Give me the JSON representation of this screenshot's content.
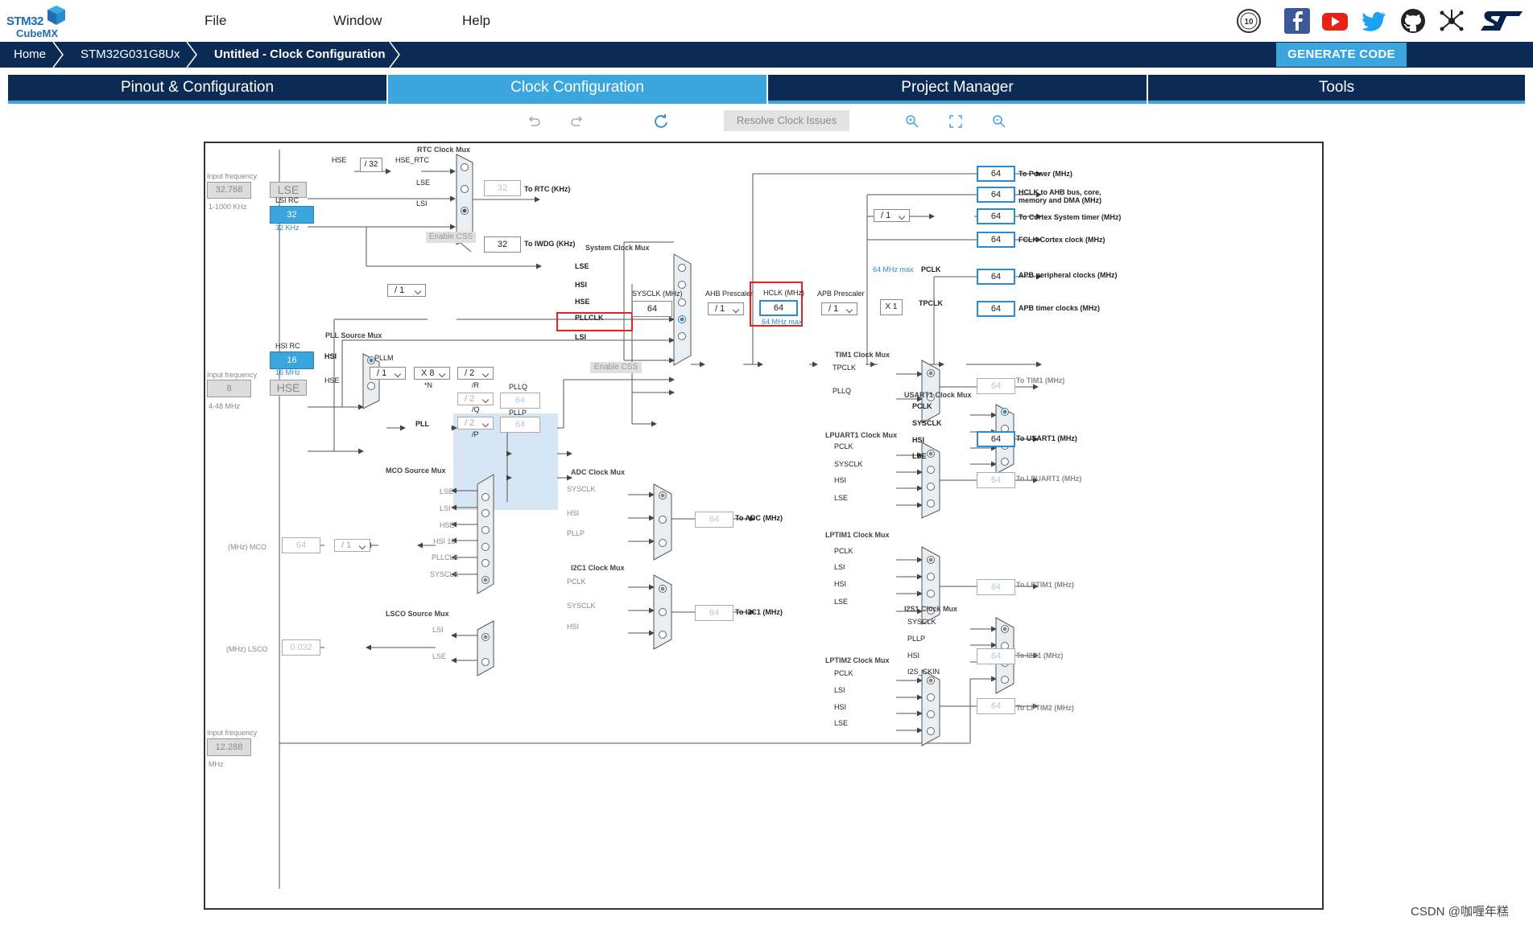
{
  "app": {
    "logo_line1": "STM32",
    "logo_line2": "CubeMX"
  },
  "menu": {
    "file": "File",
    "window": "Window",
    "help": "Help"
  },
  "breadcrumb": {
    "home": "Home",
    "device": "STM32G031G8Ux",
    "project": "Untitled - Clock Configuration"
  },
  "generate_code": "GENERATE CODE",
  "tabs": {
    "pinout": "Pinout & Configuration",
    "clock": "Clock Configuration",
    "project": "Project Manager",
    "tools": "Tools"
  },
  "toolbar": {
    "resolve": "Resolve Clock Issues"
  },
  "colors": {
    "navy": "#0b2b55",
    "accent": "#3aa6dd",
    "alert": "#e02424"
  },
  "clock": {
    "input_freq_label": "Input frequency",
    "lse_freq": "32.768",
    "lse_range": "1-1000 KHz",
    "lse": "LSE",
    "lsi_rc": "LSI RC",
    "lsi_val": "32",
    "lsi_unit": "32 KHz",
    "hsi_rc": "HSI RC",
    "hsi_val": "16",
    "hsi_unit": "16 MHz",
    "hse_freq": "8",
    "hse_range": "4-48 MHz",
    "hse": "HSE",
    "i2s_freq": "12.288",
    "i2s_unit": "MHz",
    "rtc_mux": "RTC Clock Mux",
    "hse_label": "HSE",
    "div32": "/ 32",
    "hse_rtc": "HSE_RTC",
    "lse_label": "LSE",
    "lsi_label": "LSI",
    "rtc_val": "32",
    "to_rtc": "To RTC (KHz)",
    "enable_css": "Enable CSS",
    "iwdg_val": "32",
    "to_iwdg": "To IWDG (KHz)",
    "sys_mux": "System Clock Mux",
    "sys_lse": "LSE",
    "sys_hsi": "HSI",
    "sys_hse": "HSE",
    "sys_pllclk": "PLLCLK",
    "sys_lsi": "LSI",
    "hsi_div": "/ 1",
    "pll_src_mux": "PLL Source Mux",
    "pll_hsi": "HSI",
    "pll_hse": "HSE",
    "pllm_label": "PLLM",
    "pllm": "/ 1",
    "plln": "X 8",
    "n_label": "*N",
    "pllr": "/ 2",
    "r_label": "/R",
    "pllq": "/ 2",
    "q_label": "/Q",
    "pllp": "/ 2",
    "p_label": "/P",
    "pll_label": "PLL",
    "pllq_label": "PLLQ",
    "pllq_val": "64",
    "pllp_label": "PLLP",
    "pllp_val": "64",
    "sysclk_label": "SYSCLK (MHz)",
    "sysclk": "64",
    "ahb_label": "AHB Prescaler",
    "ahb": "/ 1",
    "hclk_label": "HCLK (MHz)",
    "hclk": "64",
    "hclk_max": "64 MHz max",
    "apb_label": "APB Prescaler",
    "apb": "/ 1",
    "pclk_max": "64 MHz max",
    "pclk": "PCLK",
    "tpclk": "TPCLK",
    "x1": "X 1",
    "cortex_div": "/ 1",
    "out_power": "64",
    "to_power": "To Power (MHz)",
    "out_ahb": "64",
    "to_ahb_1": "HCLK to AHB bus, core,",
    "to_ahb_2": "memory and DMA (MHz)",
    "out_cortex": "64",
    "to_cortex": "To Cortex System timer (MHz)",
    "out_fclk": "64",
    "to_fclk": "FCLK Cortex clock (MHz)",
    "out_apb": "64",
    "to_apb": "APB peripheral clocks (MHz)",
    "out_apbt": "64",
    "to_apbt": "APB timer clocks (MHz)",
    "tim1_mux": "TIM1 Clock Mux",
    "tim1_tpclk": "TPCLK",
    "tim1_pllq": "PLLQ",
    "tim1_val": "64",
    "to_tim1": "To TIM1 (MHz)",
    "usart1_mux": "USART1 Clock Mux",
    "usart_pclk": "PCLK",
    "usart_sysclk": "SYSCLK",
    "usart_hsi": "HSI",
    "usart_lse": "LSE",
    "usart_val": "64",
    "to_usart": "To USART1 (MHz)",
    "lpuart_mux": "LPUART1 Clock Mux",
    "lpuart_pclk": "PCLK",
    "lpuart_sysclk": "SYSCLK",
    "lpuart_hsi": "HSI",
    "lpuart_lse": "LSE",
    "lpuart_val": "64",
    "to_lpuart": "To LPUART1 (MHz)",
    "lptim1_mux": "LPTIM1 Clock Mux",
    "lptim1_pclk": "PCLK",
    "lptim1_lsi": "LSI",
    "lptim1_hsi": "HSI",
    "lptim1_lse": "LSE",
    "lptim1_val": "64",
    "to_lptim1": "To LPTIM1 (MHz)",
    "i2s_mux": "I2S1 Clock Mux",
    "i2s_sysclk": "SYSCLK",
    "i2s_pllp": "PLLP",
    "i2s_hsi": "HSI",
    "i2s_ckin": "I2S_CKIN",
    "i2s_val": "64",
    "to_i2s": "To I2S1 (MHz)",
    "lptim2_mux": "LPTIM2 Clock Mux",
    "lptim2_pclk": "PCLK",
    "lptim2_lsi": "LSI",
    "lptim2_hsi": "HSI",
    "lptim2_lse": "LSE",
    "lptim2_val": "64",
    "to_lptim2": "To LPTIM2 (MHz)",
    "mco_mux": "MCO Source Mux",
    "mco_lse": "LSE",
    "mco_lsi": "LSI",
    "mco_hse": "HSE",
    "mco_hsi16": "HSI 16",
    "mco_pllclk": "PLLCLK",
    "mco_sysclk": "SYSCLK",
    "mco_div": "/ 1",
    "mco_val": "64",
    "mco_label": "(MHz) MCO",
    "lsco_mux": "LSCO Source Mux",
    "lsco_lsi": "LSI",
    "lsco_lse": "LSE",
    "lsco_val": "0.032",
    "lsco_label": "(MHz) LSCO",
    "adc_mux": "ADC Clock Mux",
    "adc_sysclk": "SYSCLK",
    "adc_hsi": "HSI",
    "adc_pllp": "PLLP",
    "adc_val": "64",
    "to_adc": "To ADC (MHz)",
    "i2c_mux": "I2C1 Clock Mux",
    "i2c_pclk": "PCLK",
    "i2c_sysclk": "SYSCLK",
    "i2c_hsi": "HSI",
    "i2c_val": "64",
    "to_i2c": "To I2C1 (MHz)"
  },
  "watermark": "CSDN @咖喱年糕"
}
